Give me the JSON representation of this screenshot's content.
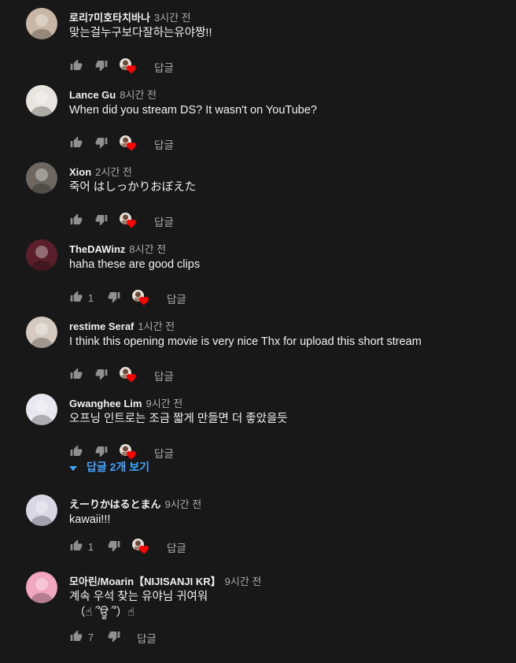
{
  "comments": [
    {
      "author": "로리7미호타치바나",
      "time": "3시간 전",
      "text": "맞는걸누구보다잘하는유야짱!!",
      "likes": "",
      "heart": true,
      "avatar_color": "#c9b7a6",
      "reply_label": "답글"
    },
    {
      "author": "Lance Gu",
      "time": "8시간 전",
      "text": "When did you stream DS? It wasn't on YouTube?",
      "likes": "",
      "heart": true,
      "avatar_color": "#e8e4df",
      "reply_label": "답글"
    },
    {
      "author": "Xion",
      "time": "2시간 전",
      "text": "죽어 はしっかりおぼえた",
      "likes": "",
      "heart": true,
      "avatar_color": "#6e6760",
      "reply_label": "답글"
    },
    {
      "author": "TheDAWinz",
      "time": "8시간 전",
      "text": "haha these are good clips",
      "likes": "1",
      "heart": true,
      "avatar_color": "#5a1f2a",
      "reply_label": "답글"
    },
    {
      "author": "restime Seraf",
      "time": "1시간 전",
      "text": "I think this opening movie is very nice Thx for upload this short stream",
      "likes": "",
      "heart": true,
      "avatar_color": "#d6c9c0",
      "reply_label": "답글"
    },
    {
      "author": "Gwanghee Lim",
      "time": "9시간 전",
      "text": "오프닝 인트로는 조금 짧게 만들면 더 좋았을듯",
      "likes": "",
      "heart": true,
      "avatar_color": "#e9e7ef",
      "reply_label": "답글",
      "view_replies": "답글 2개 보기"
    },
    {
      "author": "えーりかはるとまん",
      "time": "9시간 전",
      "text": "kawaii!!!",
      "likes": "1",
      "heart": true,
      "avatar_color": "#d9d7e6",
      "reply_label": "답글"
    },
    {
      "author": "모아린/Moarin【NIJISANJI KR】",
      "time": "9시간 전",
      "text": "계속 우석 찾는 유야님 귀여워",
      "text2": "（☝︎ ՞ਊ ՞）☝︎",
      "likes": "7",
      "heart": false,
      "avatar_color": "#f2a7c0",
      "reply_label": "답글"
    }
  ],
  "colors": {
    "background": "#181818",
    "accent": "#3ea6ff",
    "heart": "#ff0000",
    "muted": "#aaaaaa"
  },
  "icons": {
    "like": "thumb-up-icon",
    "dislike": "thumb-down-icon",
    "creator_heart": "creator-heart-icon",
    "expand": "chevron-down-icon"
  }
}
